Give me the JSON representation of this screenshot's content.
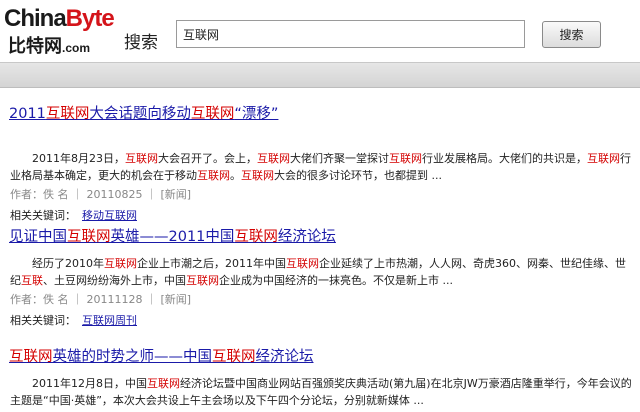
{
  "header": {
    "logo_top_a": "China",
    "logo_top_b": "Byte",
    "logo_cn": "比特网",
    "logo_com": ".com",
    "search_label": "搜索",
    "search_value": "互联网",
    "search_button": "搜索"
  },
  "results": [
    {
      "title": [
        {
          "t": "2011",
          "h": false
        },
        {
          "t": "互联网",
          "h": true
        },
        {
          "t": "大会话题向移动",
          "h": false
        },
        {
          "t": "互联网",
          "h": true
        },
        {
          "t": "“漂移”",
          "h": false
        }
      ],
      "snippet": [
        {
          "t": "　　2011年8月23日，",
          "h": false
        },
        {
          "t": "互联网",
          "h": true
        },
        {
          "t": "大会召开了。会上，",
          "h": false
        },
        {
          "t": "互联网",
          "h": true
        },
        {
          "t": "大佬们齐聚一堂探讨",
          "h": false
        },
        {
          "t": "互联网",
          "h": true
        },
        {
          "t": "行业发展格局。大佬们的共识是，",
          "h": false
        },
        {
          "t": "互联网",
          "h": true
        },
        {
          "t": "行业格局基本确定，更大的机会在于移动",
          "h": false
        },
        {
          "t": "互联网",
          "h": true
        },
        {
          "t": "。",
          "h": false
        },
        {
          "t": "互联网",
          "h": true
        },
        {
          "t": "大会的很多讨论环节，也都提到 ...",
          "h": false
        }
      ],
      "meta": "作者：佚 名 ｜ 20110825 ｜ [新闻]",
      "kw_label": "相关关键词：",
      "kw_link": "移动互联网"
    },
    {
      "title": [
        {
          "t": "见证中国",
          "h": false
        },
        {
          "t": "互联网",
          "h": true
        },
        {
          "t": "英雄——2011中国",
          "h": false
        },
        {
          "t": "互联网",
          "h": true
        },
        {
          "t": "经济论坛",
          "h": false
        }
      ],
      "snippet": [
        {
          "t": "　　经历了2010年",
          "h": false
        },
        {
          "t": "互联网",
          "h": true
        },
        {
          "t": "企业上市潮之后，2011年中国",
          "h": false
        },
        {
          "t": "互联网",
          "h": true
        },
        {
          "t": "企业延续了上市热潮，人人网、奇虎360、网秦、世纪佳缘、世纪",
          "h": false
        },
        {
          "t": "互联",
          "h": true
        },
        {
          "t": "、土豆网纷纷海外上市，中国",
          "h": false
        },
        {
          "t": "互联网",
          "h": true
        },
        {
          "t": "企业成为中国经济的一抹亮色。不仅是新上市 ...",
          "h": false
        }
      ],
      "meta": "作者：佚 名 ｜ 20111128 ｜ [新闻]",
      "kw_label": "相关关键词：",
      "kw_link": "互联网周刊"
    },
    {
      "title": [
        {
          "t": "互联网",
          "h": true
        },
        {
          "t": "英雄的时势之师——中国",
          "h": false
        },
        {
          "t": "互联网",
          "h": true
        },
        {
          "t": "经济论坛",
          "h": false
        }
      ],
      "snippet": [
        {
          "t": "　　2011年12月8日，中国",
          "h": false
        },
        {
          "t": "互联网",
          "h": true
        },
        {
          "t": "经济论坛暨中国商业网站百强颁奖庆典活动(第九届)在北京JW万豪酒店隆重举行，今年会议的主题是“中国·英雄”，本次大会共设上午主会场以及下午四个分论坛，分别就新媒体 ...",
          "h": false
        }
      ]
    }
  ]
}
